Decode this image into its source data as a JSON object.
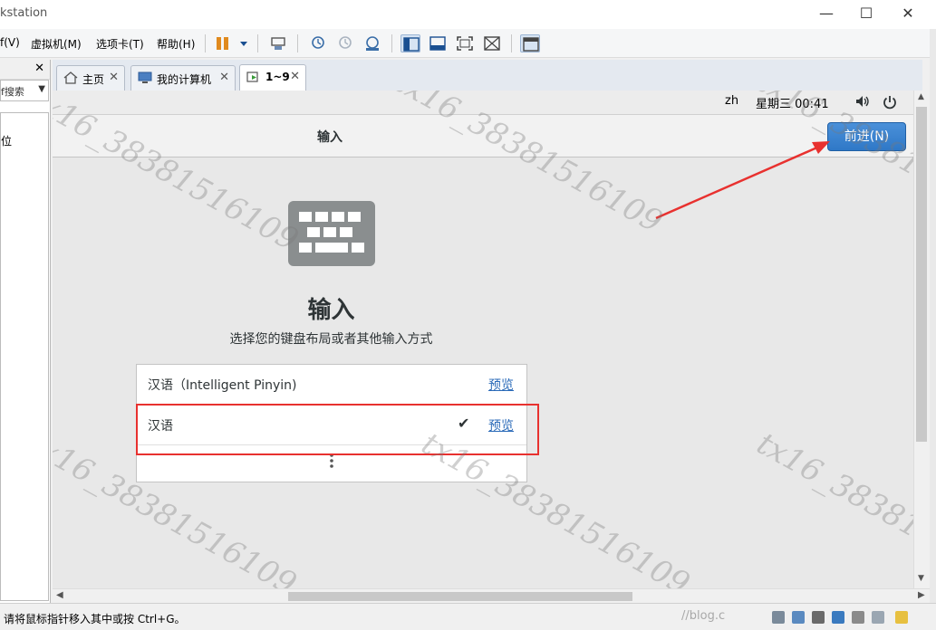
{
  "window": {
    "title": "kstation",
    "minimize_label": "—",
    "maximize_label": "☐",
    "close_label": "✕"
  },
  "menu": {
    "items": [
      "f(V)",
      "虚拟机(M)",
      "选项卡(T)",
      "帮助(H)"
    ]
  },
  "library": {
    "close_label": "✕",
    "search_placeholder": "f搜索",
    "tree_item": "位"
  },
  "tabs": [
    {
      "label": "主页",
      "icon": "home-icon"
    },
    {
      "label": "我的计算机",
      "icon": "computer-icon"
    },
    {
      "label": "1~9",
      "icon": "vm-icon",
      "active": true
    }
  ],
  "guest": {
    "topbar": {
      "lang": "zh",
      "clock": "星期三 00:41"
    },
    "header_title": "输入",
    "next_button": "前进(N)",
    "heading": "输入",
    "subheading": "选择您的键盘布局或者其他输入方式",
    "inputs": [
      {
        "label": "汉语（Intelligent Pinyin)",
        "preview": "预览",
        "selected": false
      },
      {
        "label": "汉语",
        "preview": "预览",
        "selected": true
      }
    ]
  },
  "status": {
    "text": "请将鼠标指针移入其中或按 Ctrl+G。"
  },
  "watermark": {
    "text": "tx16_3838151610​9",
    "blog": "//blog.c"
  },
  "colors": {
    "accent": "#2f78c7",
    "highlight_box": "#e8312f",
    "arrow": "#e8312f"
  }
}
